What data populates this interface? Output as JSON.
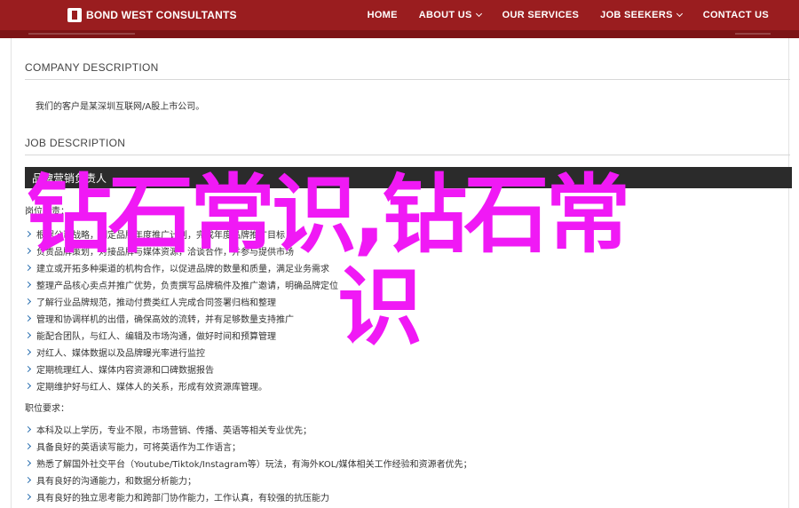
{
  "header": {
    "logo_text": "BOND WEST CONSULTANTS",
    "nav": [
      {
        "label": "HOME",
        "has_dropdown": false
      },
      {
        "label": "ABOUT US",
        "has_dropdown": true
      },
      {
        "label": "OUR SERVICES",
        "has_dropdown": false
      },
      {
        "label": "JOB SEEKERS",
        "has_dropdown": true
      },
      {
        "label": "CONTACT US",
        "has_dropdown": false
      }
    ],
    "colors": {
      "bar": "#9a1d1f",
      "overlay": "#f019f5",
      "bullet": "#2a6fb0"
    }
  },
  "company": {
    "heading": "COMPANY DESCRIPTION",
    "text": "我们的客户是某深圳互联网/A股上市公司。"
  },
  "job": {
    "heading": "JOB DESCRIPTION",
    "title": "品牌营销负责人",
    "responsibilities_label": "岗位职责：",
    "responsibilities": [
      "根据公司战略，制定品牌年度推广计划，完成年度品牌推广目标",
      "负责品牌策划，对接品牌与媒体资源，洽谈合作，并参与提供市场",
      "建立或开拓多种渠道的机构合作，以促进品牌的数量和质量，满足业务需求",
      "整理产品核心卖点并推广优势，负责撰写品牌稿件及推广邀请，明确品牌定位",
      "了解行业品牌规范，推动付费类红人完成合同签署归档和整理",
      "管理和协调样机的出借，确保高效的流转，并有足够数量支持推广",
      "能配合团队，与红人、编辑及市场沟通，做好时间和预算管理",
      "对红人、媒体数据以及品牌曝光率进行监控",
      "定期梳理红人、媒体内容资源和口碑数据报告",
      "定期维护好与红人、媒体人的关系，形成有效资源库管理。"
    ],
    "requirements_label": "职位要求：",
    "requirements": [
      "本科及以上学历，专业不限，市场营销、传播、英语等相关专业优先；",
      "具备良好的英语读写能力，可将英语作为工作语言；",
      "熟悉了解国外社交平台（Youtube/Tiktok/Instagram等）玩法，有海外KOL/媒体相关工作经验和资源者优先；",
      "具有良好的沟通能力，和数据分析能力；",
      "具有良好的独立思考能力和跨部门协作能力，工作认真，有较强的抗压能力"
    ]
  },
  "overlay": {
    "line1": "钻石常识,钻石常",
    "line2": "识"
  }
}
